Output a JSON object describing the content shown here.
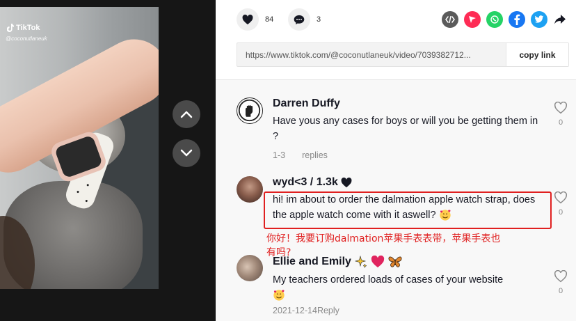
{
  "video": {
    "brand": "TikTok",
    "handle": "@coconutlaneuk"
  },
  "nav": {
    "up_icon": "chevron-up-icon",
    "down_icon": "chevron-down-icon"
  },
  "stats": {
    "likes": "84",
    "comments": "3"
  },
  "share_icons": [
    "embed-icon",
    "send-icon",
    "whatsapp-icon",
    "facebook-icon",
    "twitter-icon",
    "share-arrow-icon"
  ],
  "share_colors": {
    "embed": "#5b5b5b",
    "send": "#fe2c55",
    "whatsapp": "#25d366",
    "facebook": "#1877f2",
    "twitter": "#1da1f2"
  },
  "link": {
    "url": "https://www.tiktok.com/@coconutlaneuk/video/7039382712...",
    "copy_label": "copy link"
  },
  "comments": [
    {
      "name": "Darren Duffy",
      "text": "Have yous any cases for boys or will you be getting them in ?",
      "date": "1-3",
      "replies": "replies",
      "likes": "0"
    },
    {
      "name": "wyd<3 / 1.3k",
      "text": "hi! im about to order the dalmation apple watch strap, does the apple watch come with it aswell?",
      "likes": "0"
    },
    {
      "name": "Ellie and Emily",
      "text": "My teachers ordered loads of cases of your website",
      "date": "2021-12-14",
      "reply": "Reply",
      "likes": "0"
    }
  ],
  "annotation": {
    "translation": "你好！我要订购dalmation苹果手表表带，苹果手表也有吗?",
    "color": "#e02020"
  }
}
